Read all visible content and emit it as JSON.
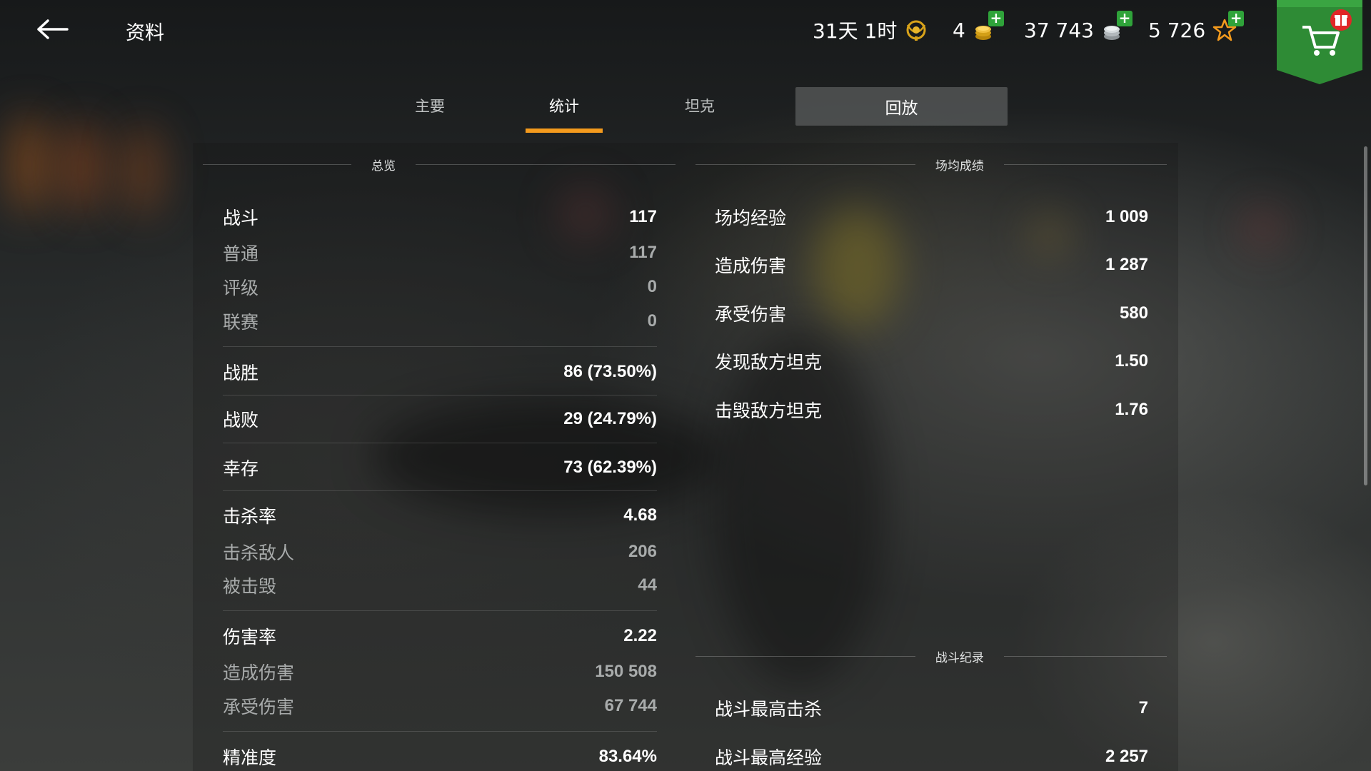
{
  "header": {
    "title": "资料",
    "currencies": [
      {
        "value": "31天 1时",
        "icon": "premium-time-icon"
      },
      {
        "value": "4",
        "icon": "gold-coins-icon"
      },
      {
        "value": "37 743",
        "icon": "silver-credits-icon"
      },
      {
        "value": "5 726",
        "icon": "free-xp-star-icon"
      }
    ]
  },
  "tabs": [
    {
      "label": "主要"
    },
    {
      "label": "统计"
    },
    {
      "label": "坦克"
    },
    {
      "label": "回放"
    }
  ],
  "overview": {
    "title": "总览",
    "rows": [
      {
        "label": "战斗",
        "value": "117"
      },
      {
        "label": "普通",
        "value": "117"
      },
      {
        "label": "评级",
        "value": "0"
      },
      {
        "label": "联赛",
        "value": "0"
      },
      {
        "label": "战胜",
        "value": "86 (73.50%)"
      },
      {
        "label": "战败",
        "value": "29 (24.79%)"
      },
      {
        "label": "幸存",
        "value": "73 (62.39%)"
      },
      {
        "label": "击杀率",
        "value": "4.68"
      },
      {
        "label": "击杀敌人",
        "value": "206"
      },
      {
        "label": "被击毁",
        "value": "44"
      },
      {
        "label": "伤害率",
        "value": "2.22"
      },
      {
        "label": "造成伤害",
        "value": "150 508"
      },
      {
        "label": "承受伤害",
        "value": "67 744"
      },
      {
        "label": "精准度",
        "value": "83.64%"
      }
    ]
  },
  "averages": {
    "title": "场均成绩",
    "rows": [
      {
        "label": "场均经验",
        "value": "1 009"
      },
      {
        "label": "造成伤害",
        "value": "1 287"
      },
      {
        "label": "承受伤害",
        "value": "580"
      },
      {
        "label": "发现敌方坦克",
        "value": "1.50"
      },
      {
        "label": "击毁敌方坦克",
        "value": "1.76"
      }
    ]
  },
  "records": {
    "title": "战斗纪录",
    "rows": [
      {
        "label": "战斗最高击杀",
        "value": "7"
      },
      {
        "label": "战斗最高经验",
        "value": "2 257"
      }
    ]
  },
  "colors": {
    "accent": "#f39a1d",
    "plus_button": "#2fa33a",
    "shop_banner": "#2e8b35",
    "gift_badge": "#e02727"
  }
}
